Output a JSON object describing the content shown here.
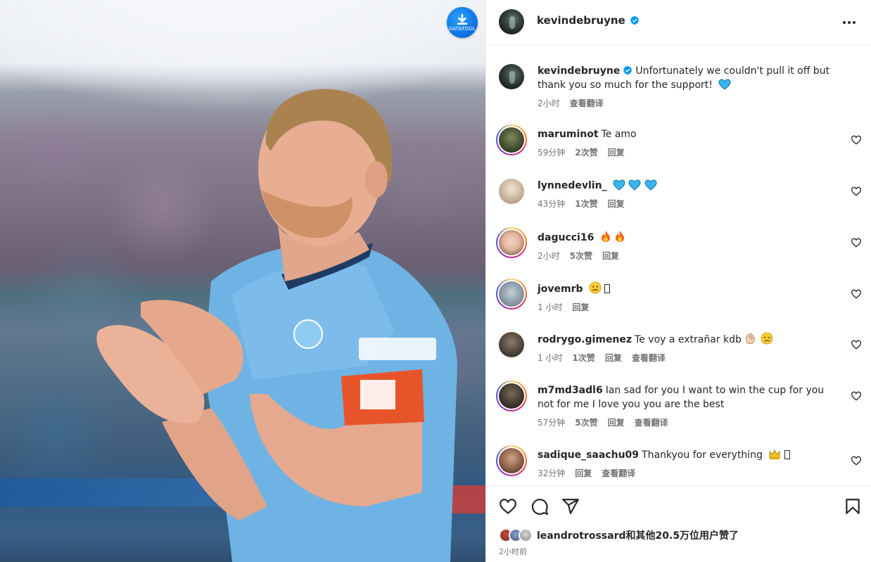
{
  "post": {
    "author": "kevindebruyne",
    "caption": "Unfortunately we couldn't pull it off but thank you so much for the support!",
    "caption_time": "2小时",
    "caption_translate": "查看翻译",
    "photo_alt": "Kevin De Bruyne applauding in a light-blue Manchester City kit with an Emirates FA Cup captain armband"
  },
  "badge": {
    "label": "DATATOOL"
  },
  "comments": [
    {
      "user": "maruminot",
      "text": "Te amo",
      "time": "59分钟",
      "likes": "2次赞",
      "reply": "回复"
    },
    {
      "user": "lynnedevlin_",
      "text": "",
      "time": "43分钟",
      "likes": "1次赞",
      "reply": "回复"
    },
    {
      "user": "dagucci16",
      "text": "",
      "time": "2小时",
      "likes": "5次赞",
      "reply": "回复"
    },
    {
      "user": "jovemrb",
      "text": "",
      "time": "1 小时",
      "reply": "回复"
    },
    {
      "user": "rodrygo.gimenez",
      "text": "Te voy a extrañar kdb",
      "time": "1 小时",
      "likes": "1次赞",
      "reply": "回复",
      "translate": "查看翻译"
    },
    {
      "user": "m7md3adl6",
      "text": "Ian sad for you I want to win the cup for you not for me I love you you are the best",
      "time": "57分钟",
      "likes": "5次赞",
      "reply": "回复",
      "translate": "查看翻译"
    },
    {
      "user": "sadique_saachu09",
      "text": "Thankyou for everything",
      "time": "32分钟",
      "reply": "回复",
      "translate": "查看翻译"
    }
  ],
  "footer": {
    "likes_user": "leandrotrossard",
    "likes_text": "和其他20.5万位用户赞了",
    "time": "2小时前"
  },
  "icons": {
    "verified": "verified-badge-icon",
    "more": "more-options-icon",
    "like": "heart-icon",
    "comment": "comment-icon",
    "share": "share-icon",
    "save": "bookmark-icon",
    "download": "download-icon"
  },
  "colors": {
    "verified": "#0095f6",
    "heart_emoji": "#36b6f0",
    "text": "#262626",
    "muted": "#737373",
    "badge": "#0a6fe0"
  }
}
